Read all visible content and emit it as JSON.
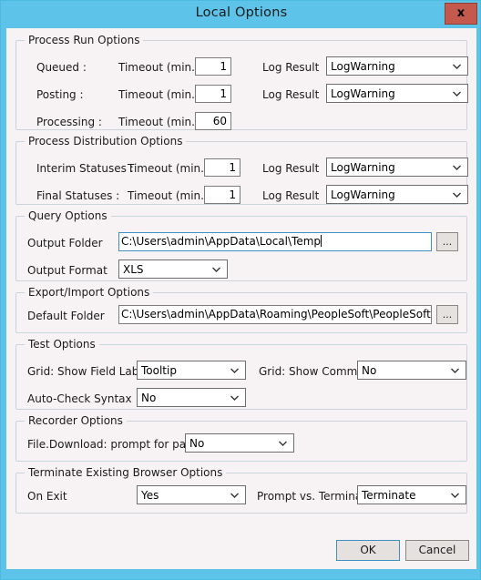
{
  "window": {
    "title": "Local Options",
    "close_label": "x",
    "frame_color": "#5ec3e8",
    "body_color": "#f7f3f5",
    "close_color": "#c4594e",
    "focus_color": "#3d8fc4"
  },
  "process_run_options": {
    "legend": "Process Run Options",
    "rows": [
      {
        "name": "Queued :",
        "timeout_label": "Timeout (min.)",
        "timeout_value": "1",
        "log_label": "Log Result",
        "log_value": "LogWarning"
      },
      {
        "name": "Posting :",
        "timeout_label": "Timeout (min.)",
        "timeout_value": "1",
        "log_label": "Log Result",
        "log_value": "LogWarning"
      },
      {
        "name": "Processing :",
        "timeout_label": "Timeout (min.)",
        "timeout_value": "60",
        "log_label": "",
        "log_value": ""
      }
    ]
  },
  "process_distribution_options": {
    "legend": "Process Distribution Options",
    "rows": [
      {
        "name": "Interim Statuses :",
        "timeout_label": "Timeout (min.)",
        "timeout_value": "1",
        "log_label": "Log Result",
        "log_value": "LogWarning"
      },
      {
        "name": "Final Statuses :",
        "timeout_label": "Timeout (min.)",
        "timeout_value": "1",
        "log_label": "Log Result",
        "log_value": "LogWarning"
      }
    ]
  },
  "query_options": {
    "legend": "Query Options",
    "output_folder_label": "Output Folder",
    "output_folder_value": "C:\\Users\\admin\\AppData\\Local\\Temp",
    "browse_label": "...",
    "output_format_label": "Output Format",
    "output_format_value": "XLS"
  },
  "export_import_options": {
    "legend": "Export/Import Options",
    "default_folder_label": "Default Folder",
    "default_folder_value": "C:\\Users\\admin\\AppData\\Roaming\\PeopleSoft\\PeopleSoft Test Fram",
    "browse_label": "..."
  },
  "test_options": {
    "legend": "Test Options",
    "show_field_label_label": "Grid: Show Field Label",
    "show_field_label_value": "Tooltip",
    "show_comment_label": "Grid: Show Comment",
    "show_comment_value": "No",
    "auto_check_syntax_label": "Auto-Check Syntax",
    "auto_check_syntax_value": "No"
  },
  "recorder_options": {
    "legend": "Recorder Options",
    "prompt_for_path_label": "File.Download: prompt for path",
    "prompt_for_path_value": "No"
  },
  "terminate_options": {
    "legend": "Terminate Existing Browser Options",
    "on_exit_label": "On Exit",
    "on_exit_value": "Yes",
    "prompt_vs_terminate_label": "Prompt vs. Terminate",
    "prompt_vs_terminate_value": "Terminate"
  },
  "footer": {
    "ok_label": "OK",
    "cancel_label": "Cancel"
  }
}
